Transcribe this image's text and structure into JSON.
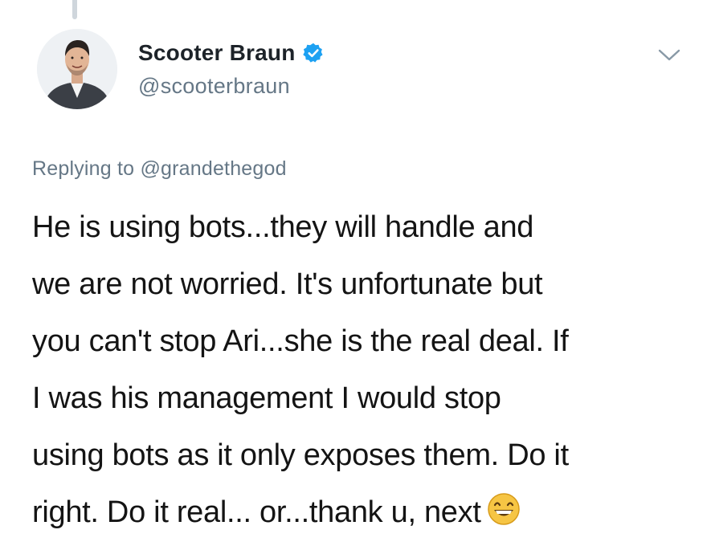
{
  "tweet": {
    "author": {
      "display_name": "Scooter Braun",
      "handle": "@scooterbraun",
      "verified_icon": "verified-badge-icon",
      "avatar": "profile-photo"
    },
    "menu_icon": "chevron-down-icon",
    "reply_context": {
      "prefix": "Replying to",
      "handle": "@grandethegod"
    },
    "text_lines": [
      "He is using bots...they will handle and",
      "we are not worried. It's unfortunate but",
      "you can't stop Ari...she is the real deal. If",
      "I was his management I would stop",
      "using bots as it only exposes them. Do it",
      "right. Do it real... or...thank u, next"
    ],
    "trailing_emoji": "grinning-face-emoji",
    "colors": {
      "verified": "#1da1f2",
      "secondary_text": "#657786",
      "primary_text": "#141414"
    }
  }
}
